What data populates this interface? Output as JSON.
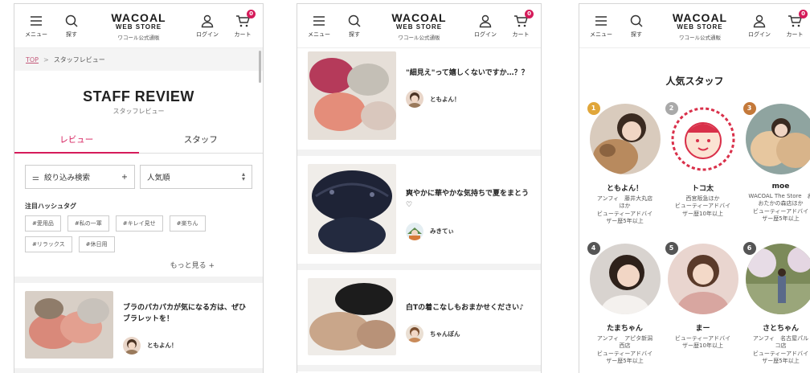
{
  "header": {
    "menu_label": "メニュー",
    "search_label": "探す",
    "logo_line1": "WACOAL",
    "logo_line2": "WEB STORE",
    "logo_line3": "ワコール公式通販",
    "login_label": "ログイン",
    "cart_label": "カート",
    "cart_count": "0"
  },
  "review_page": {
    "breadcrumb_top": "TOP",
    "breadcrumb_sep": ">",
    "breadcrumb_current": "スタッフレビュー",
    "title": "STAFF REVIEW",
    "subtitle": "スタッフレビュー",
    "tabs": [
      "レビュー",
      "スタッフ"
    ],
    "filter_label": "絞り込み検索",
    "filter_plus": "+",
    "sort_value": "人気順",
    "hashtag_title": "注目ハッシュタグ",
    "hashtags": [
      "#愛用品",
      "#私の一軍",
      "#キレイ見せ",
      "#楽ちん",
      "#リラックス",
      "#休日用"
    ],
    "more_label": "もっと見る +",
    "first_item": {
      "title": "ブラのパカパカが気になる方は、ぜひブラレットを！",
      "author": "ともよん！"
    }
  },
  "feed_page": {
    "items": [
      {
        "title": "\"細見え\"って嬉しくないですか…？？",
        "author": "ともよん！"
      },
      {
        "title": "爽やかに華やかな気持ちで夏をまとう♡",
        "author": "みきてぃ"
      },
      {
        "title": "白Tの着こなしもおまかせください♪",
        "author": "ちゃんぽん"
      }
    ]
  },
  "staff_page": {
    "title": "人気スタッフ",
    "staff": [
      {
        "rank": "1",
        "name": "ともよん！",
        "desc": "アンフィ　藤井大丸店\nほか\nビューティーアドバイ\nザー歴5年以上",
        "rank_color": "#e0a63a"
      },
      {
        "rank": "2",
        "name": "トコ太",
        "desc": "西宮阪急ほか\nビューティーアドバイ\nザー歴10年以上",
        "rank_color": "#a9a9a9"
      },
      {
        "rank": "3",
        "name": "moe",
        "desc": "WACOAL The Store　お\nおたかの森店ほか\nビューティーアドバイ\nザー歴5年以上",
        "rank_color": "#c4793a"
      },
      {
        "rank": "4",
        "name": "たまちゃん",
        "desc": "アンフィ　アピタ新潟\n西店\nビューティーアドバイ\nザー歴5年以上",
        "rank_color": "#555555"
      },
      {
        "rank": "5",
        "name": "まー",
        "desc": "ビューティーアドバイ\nザー歴10年以上",
        "rank_color": "#555555"
      },
      {
        "rank": "6",
        "name": "さとちゃん",
        "desc": "アンフィ　名古屋パル\nコ店\nビューティーアドバイ\nザー歴5年以上",
        "rank_color": "#555555"
      }
    ]
  },
  "colors": {
    "accent": "#d51b5a",
    "breadcrumb_link": "#c45a7b"
  }
}
